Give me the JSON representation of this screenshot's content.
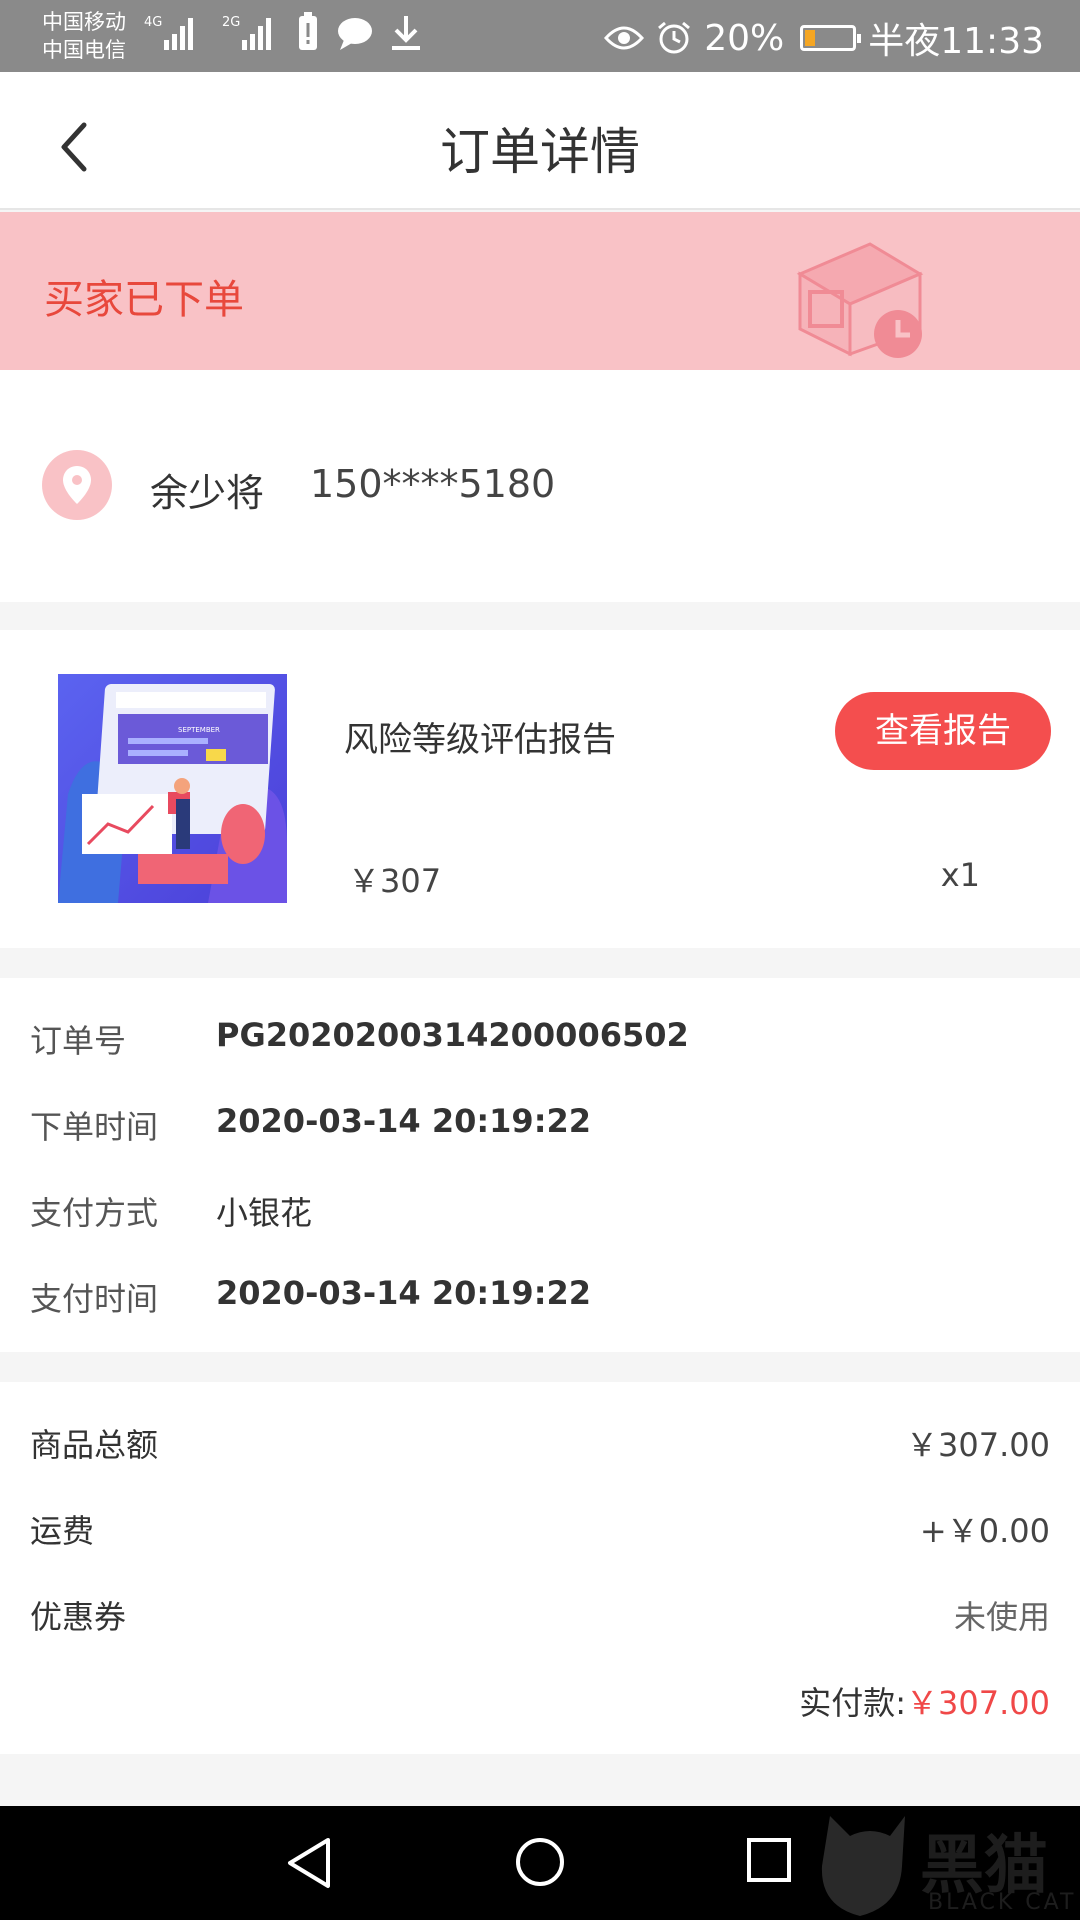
{
  "status_bar": {
    "carrier_1": "中国移动",
    "carrier_2": "中国电信",
    "net_1": "4G",
    "net_2": "2G",
    "battery": "20%",
    "time": "半夜11:33",
    "battery_level": 0.2
  },
  "header": {
    "title": "订单详情",
    "back_icon": "chevron-left-icon"
  },
  "banner": {
    "status_text": "买家已下单",
    "icon": "box-clock-icon",
    "bg_color": "#f9c2c6",
    "text_color": "#e8483c"
  },
  "address": {
    "name": "余少将",
    "phone": "150****5180",
    "icon": "location-pin-icon"
  },
  "product": {
    "name": "风险等级评估报告",
    "button": "查看报告",
    "price": "￥307",
    "quantity": "x1",
    "thumb_text": "SEPTEMBER"
  },
  "order_info": {
    "rows": [
      {
        "label": "订单号",
        "value": "PG202020031420000 6502"
      },
      {
        "label": "下单时间",
        "value": "2020-03-14 20:19:22"
      },
      {
        "label": "支付方式",
        "value": "小银花"
      },
      {
        "label": "支付时间",
        "value": "2020-03-14 20:19:22"
      }
    ]
  },
  "totals": {
    "goods_label": "商品总额",
    "goods_value": "￥307.00",
    "shipping_label": "运费",
    "shipping_value": "+￥0.00",
    "coupon_label": "优惠券",
    "coupon_value": "未使用",
    "paid_label": "实付款:",
    "paid_value": "￥307.00",
    "accent_color": "#f04848"
  },
  "watermark": {
    "text": "黑猫",
    "sub": "BLACK CAT"
  }
}
